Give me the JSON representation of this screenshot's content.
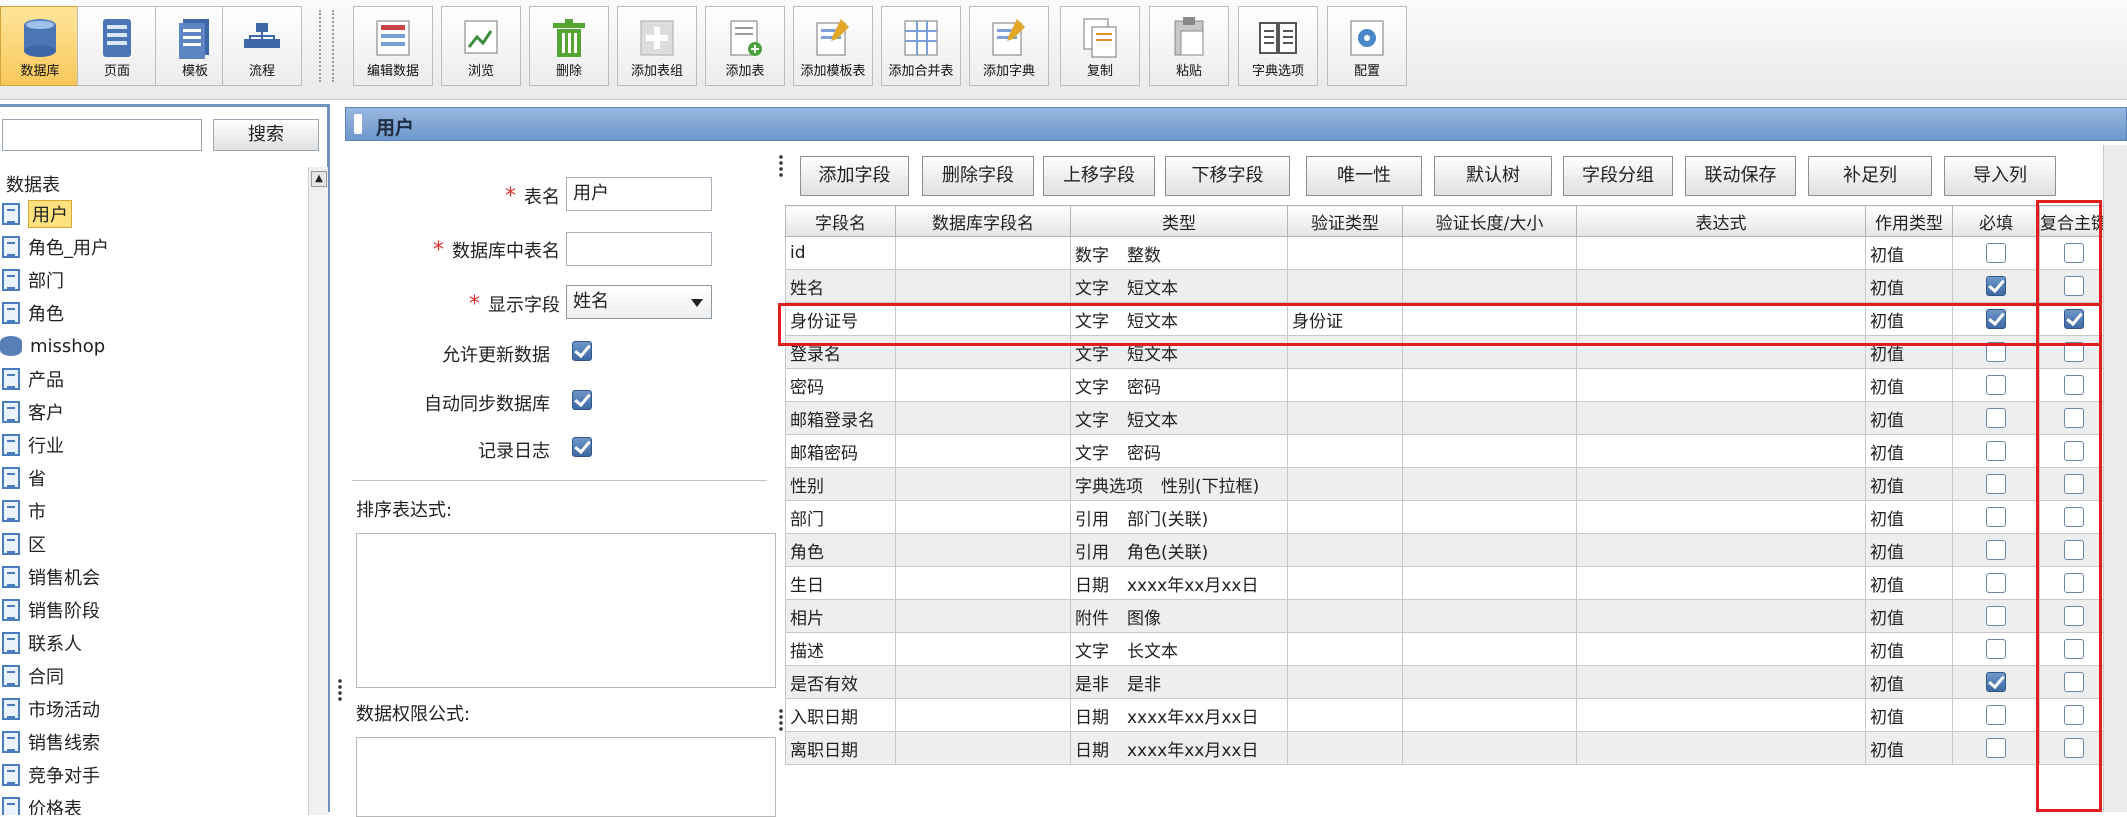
{
  "toolbar": {
    "buttons": [
      {
        "label": "数据库",
        "icon": "database-icon",
        "active": true
      },
      {
        "label": "页面",
        "icon": "page-icon"
      },
      {
        "label": "模板",
        "icon": "template-icon"
      },
      {
        "label": "流程",
        "icon": "flow-icon"
      },
      {
        "label": "编辑数据",
        "icon": "edit-data-icon"
      },
      {
        "label": "浏览",
        "icon": "browse-icon"
      },
      {
        "label": "删除",
        "icon": "trash-icon"
      },
      {
        "label": "添加表组",
        "icon": "add-group-icon"
      },
      {
        "label": "添加表",
        "icon": "add-table-icon"
      },
      {
        "label": "添加模板表",
        "icon": "add-template-table-icon"
      },
      {
        "label": "添加合并表",
        "icon": "add-merge-table-icon"
      },
      {
        "label": "添加字典",
        "icon": "add-dictionary-icon"
      },
      {
        "label": "复制",
        "icon": "copy-icon"
      },
      {
        "label": "粘贴",
        "icon": "paste-icon"
      },
      {
        "label": "字典选项",
        "icon": "dictionary-options-icon"
      },
      {
        "label": "配置",
        "icon": "config-icon"
      }
    ]
  },
  "sidebar": {
    "search_button": "搜索",
    "root_label": "数据表",
    "items": [
      {
        "label": "用户",
        "selected": true,
        "icon": "table-icon"
      },
      {
        "label": "角色_用户",
        "icon": "table-icon"
      },
      {
        "label": "部门",
        "icon": "table-icon"
      },
      {
        "label": "角色",
        "icon": "table-icon"
      },
      {
        "label": "misshop",
        "icon": "database-icon"
      },
      {
        "label": "产品",
        "icon": "table-icon"
      },
      {
        "label": "客户",
        "icon": "table-icon"
      },
      {
        "label": "行业",
        "icon": "table-icon"
      },
      {
        "label": "省",
        "icon": "table-icon"
      },
      {
        "label": "市",
        "icon": "table-icon"
      },
      {
        "label": "区",
        "icon": "table-icon"
      },
      {
        "label": "销售机会",
        "icon": "table-icon"
      },
      {
        "label": "销售阶段",
        "icon": "table-icon"
      },
      {
        "label": "联系人",
        "icon": "table-icon"
      },
      {
        "label": "合同",
        "icon": "table-icon"
      },
      {
        "label": "市场活动",
        "icon": "table-icon"
      },
      {
        "label": "销售线索",
        "icon": "table-icon"
      },
      {
        "label": "竞争对手",
        "icon": "table-icon"
      },
      {
        "label": "价格表",
        "icon": "table-icon"
      }
    ]
  },
  "panel": {
    "title": "用户"
  },
  "form": {
    "table_name_label": "表名",
    "table_name_value": "用户",
    "db_table_name_label": "数据库中表名",
    "db_table_name_value": "",
    "display_field_label": "显示字段",
    "display_field_value": "姓名",
    "allow_update_label": "允许更新数据",
    "allow_update": true,
    "auto_sync_label": "自动同步数据库",
    "auto_sync": true,
    "log_label": "记录日志",
    "log": true,
    "sort_expr_label": "排序表达式:",
    "permission_expr_label": "数据权限公式:"
  },
  "field_buttons": [
    "添加字段",
    "删除字段",
    "上移字段",
    "下移字段",
    "唯一性",
    "默认树",
    "字段分组",
    "联动保存",
    "补足列",
    "导入列"
  ],
  "grid": {
    "headers": [
      "字段名",
      "数据库字段名",
      "类型",
      "验证类型",
      "验证长度/大小",
      "表达式",
      "作用类型",
      "必填",
      "复合主键"
    ],
    "rows": [
      {
        "name": "id",
        "db": "",
        "type1": "数字",
        "type2": "整数",
        "valid": "",
        "len": "",
        "expr": "",
        "usage": "初值",
        "required": false,
        "pk": false
      },
      {
        "name": "姓名",
        "db": "",
        "type1": "文字",
        "type2": "短文本",
        "valid": "",
        "len": "",
        "expr": "",
        "usage": "初值",
        "required": true,
        "pk": false
      },
      {
        "name": "身份证号",
        "db": "",
        "type1": "文字",
        "type2": "短文本",
        "valid": "身份证",
        "len": "",
        "expr": "",
        "usage": "初值",
        "required": true,
        "pk": true
      },
      {
        "name": "登录名",
        "db": "",
        "type1": "文字",
        "type2": "短文本",
        "valid": "",
        "len": "",
        "expr": "",
        "usage": "初值",
        "required": false,
        "pk": false
      },
      {
        "name": "密码",
        "db": "",
        "type1": "文字",
        "type2": "密码",
        "valid": "",
        "len": "",
        "expr": "",
        "usage": "初值",
        "required": false,
        "pk": false
      },
      {
        "name": "邮箱登录名",
        "db": "",
        "type1": "文字",
        "type2": "短文本",
        "valid": "",
        "len": "",
        "expr": "",
        "usage": "初值",
        "required": false,
        "pk": false
      },
      {
        "name": "邮箱密码",
        "db": "",
        "type1": "文字",
        "type2": "密码",
        "valid": "",
        "len": "",
        "expr": "",
        "usage": "初值",
        "required": false,
        "pk": false
      },
      {
        "name": "性别",
        "db": "",
        "type1": "字典选项",
        "type2": "性别(下拉框)",
        "valid": "",
        "len": "",
        "expr": "",
        "usage": "初值",
        "required": false,
        "pk": false
      },
      {
        "name": "部门",
        "db": "",
        "type1": "引用",
        "type2": "部门(关联)",
        "valid": "",
        "len": "",
        "expr": "",
        "usage": "初值",
        "required": false,
        "pk": false
      },
      {
        "name": "角色",
        "db": "",
        "type1": "引用",
        "type2": "角色(关联)",
        "valid": "",
        "len": "",
        "expr": "",
        "usage": "初值",
        "required": false,
        "pk": false
      },
      {
        "name": "生日",
        "db": "",
        "type1": "日期",
        "type2": "xxxx年xx月xx日",
        "valid": "",
        "len": "",
        "expr": "",
        "usage": "初值",
        "required": false,
        "pk": false
      },
      {
        "name": "相片",
        "db": "",
        "type1": "附件",
        "type2": "图像",
        "valid": "",
        "len": "",
        "expr": "",
        "usage": "初值",
        "required": false,
        "pk": false
      },
      {
        "name": "描述",
        "db": "",
        "type1": "文字",
        "type2": "长文本",
        "valid": "",
        "len": "",
        "expr": "",
        "usage": "初值",
        "required": false,
        "pk": false
      },
      {
        "name": "是否有效",
        "db": "",
        "type1": "是非",
        "type2": "是非",
        "valid": "",
        "len": "",
        "expr": "",
        "usage": "初值",
        "required": true,
        "pk": false
      },
      {
        "name": "入职日期",
        "db": "",
        "type1": "日期",
        "type2": "xxxx年xx月xx日",
        "valid": "",
        "len": "",
        "expr": "",
        "usage": "初值",
        "required": false,
        "pk": false
      },
      {
        "name": "离职日期",
        "db": "",
        "type1": "日期",
        "type2": "xxxx年xx月xx日",
        "valid": "",
        "len": "",
        "expr": "",
        "usage": "初值",
        "required": false,
        "pk": false
      }
    ]
  },
  "colors": {
    "accent": "#6e97cb",
    "highlight": "#e21d1d",
    "selected": "#ffe180"
  }
}
